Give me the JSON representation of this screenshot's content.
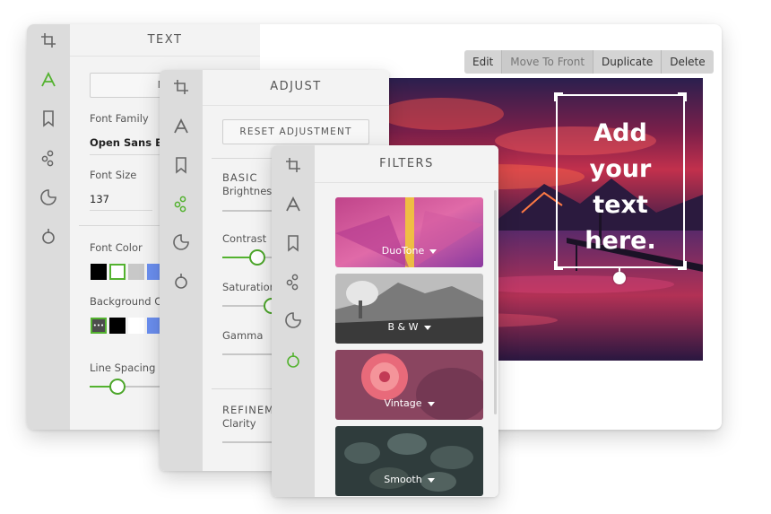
{
  "text_panel": {
    "title": "TEXT",
    "new_button": "NEW",
    "font_family_label": "Font Family",
    "font_family_value": "Open Sans Bo",
    "font_size_label": "Font Size",
    "font_size_value": "137",
    "font_color_label": "Font Color",
    "background_color_label": "Background Co",
    "line_spacing_label": "Line Spacing",
    "font_colors": [
      "#000000",
      "#ffffff",
      "#c8c8c8",
      "#6b8ff0"
    ],
    "background_colors": [
      "#4d4d4d",
      "#000000",
      "#ffffff",
      "#6b8ff0"
    ],
    "more_glyph": "•••",
    "line_spacing_level": 0.3
  },
  "toolbar": {
    "edit": "Edit",
    "move_to_front": "Move To Front",
    "duplicate": "Duplicate",
    "delete": "Delete"
  },
  "canvas": {
    "text_line1": "Add",
    "text_line2": "your",
    "text_line3": "text",
    "text_line4": "here."
  },
  "adjust_panel": {
    "title": "ADJUST",
    "reset_button": "RESET ADJUSTMENT",
    "basic_label": "BASIC",
    "brightness_label": "Brightness",
    "contrast_label": "Contrast",
    "saturation_label": "Saturation",
    "gamma_label": "Gamma",
    "refinement_label": "REFINEM",
    "clarity_label": "Clarity",
    "contrast_level": 0.5,
    "saturation_level": 0.5
  },
  "filters_panel": {
    "title": "FILTERS",
    "filters": [
      {
        "name": "DuoTone"
      },
      {
        "name": "B & W"
      },
      {
        "name": "Vintage"
      },
      {
        "name": "Smooth"
      }
    ]
  },
  "colors": {
    "accent_green": "#53b22f",
    "rail_bg": "#dcdcdc",
    "panel_bg": "#f3f3f3"
  },
  "icons": [
    "crop-icon",
    "text-icon",
    "bookmark-icon",
    "adjust-icon",
    "sticker-icon",
    "filter-icon"
  ]
}
